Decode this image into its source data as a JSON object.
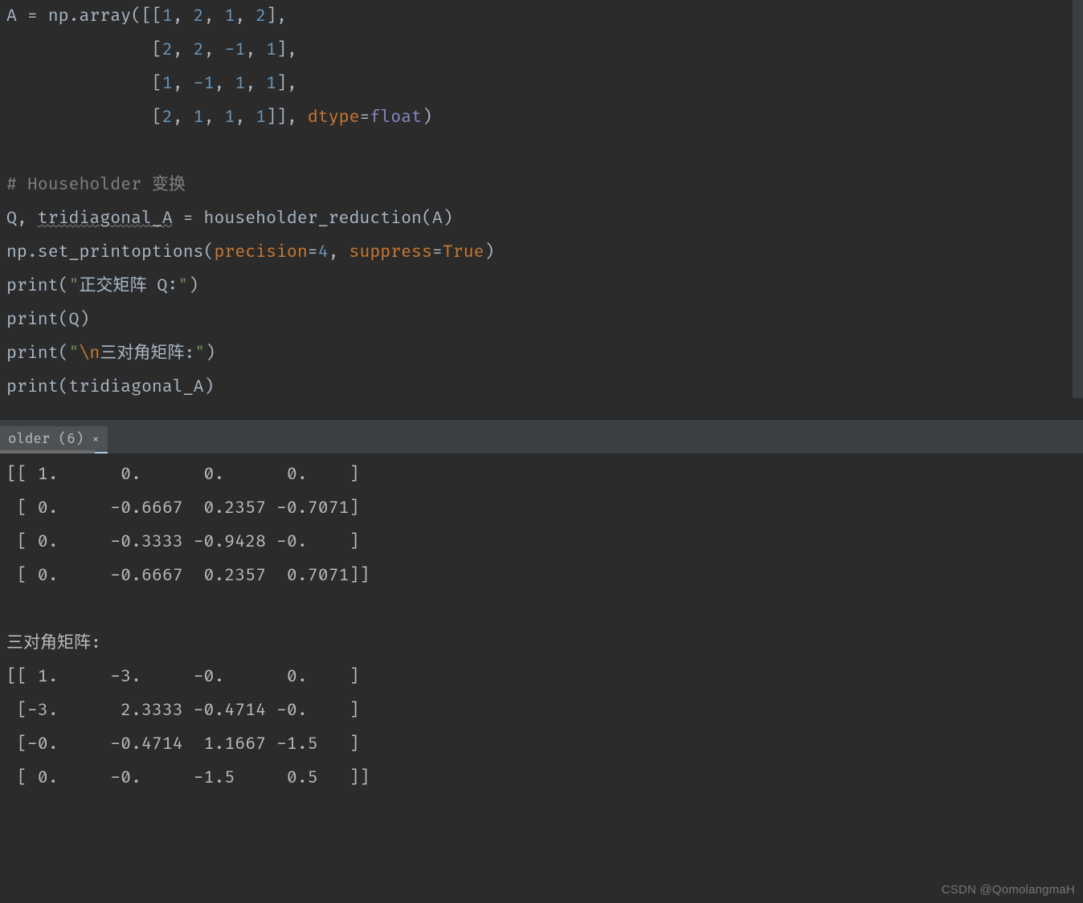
{
  "editor": {
    "lines": [
      {
        "segments": [
          {
            "t": "A = np.array([[",
            "c": "tok-def"
          },
          {
            "t": "1",
            "c": "tok-num"
          },
          {
            "t": ", ",
            "c": "tok-def"
          },
          {
            "t": "2",
            "c": "tok-num"
          },
          {
            "t": ", ",
            "c": "tok-def"
          },
          {
            "t": "1",
            "c": "tok-num"
          },
          {
            "t": ", ",
            "c": "tok-def"
          },
          {
            "t": "2",
            "c": "tok-num"
          },
          {
            "t": "],",
            "c": "tok-def"
          }
        ]
      },
      {
        "segments": [
          {
            "t": "              [",
            "c": "tok-def"
          },
          {
            "t": "2",
            "c": "tok-num"
          },
          {
            "t": ", ",
            "c": "tok-def"
          },
          {
            "t": "2",
            "c": "tok-num"
          },
          {
            "t": ", ",
            "c": "tok-def"
          },
          {
            "t": "-1",
            "c": "tok-num"
          },
          {
            "t": ", ",
            "c": "tok-def"
          },
          {
            "t": "1",
            "c": "tok-num"
          },
          {
            "t": "],",
            "c": "tok-def"
          }
        ]
      },
      {
        "segments": [
          {
            "t": "              [",
            "c": "tok-def"
          },
          {
            "t": "1",
            "c": "tok-num"
          },
          {
            "t": ", ",
            "c": "tok-def"
          },
          {
            "t": "-1",
            "c": "tok-num"
          },
          {
            "t": ", ",
            "c": "tok-def"
          },
          {
            "t": "1",
            "c": "tok-num"
          },
          {
            "t": ", ",
            "c": "tok-def"
          },
          {
            "t": "1",
            "c": "tok-num"
          },
          {
            "t": "],",
            "c": "tok-def"
          }
        ]
      },
      {
        "segments": [
          {
            "t": "              [",
            "c": "tok-def"
          },
          {
            "t": "2",
            "c": "tok-num"
          },
          {
            "t": ", ",
            "c": "tok-def"
          },
          {
            "t": "1",
            "c": "tok-num"
          },
          {
            "t": ", ",
            "c": "tok-def"
          },
          {
            "t": "1",
            "c": "tok-num"
          },
          {
            "t": ", ",
            "c": "tok-def"
          },
          {
            "t": "1",
            "c": "tok-num"
          },
          {
            "t": "]], ",
            "c": "tok-def"
          },
          {
            "t": "dtype",
            "c": "tok-kw"
          },
          {
            "t": "=",
            "c": "tok-def"
          },
          {
            "t": "float",
            "c": "tok-fn"
          },
          {
            "t": ")",
            "c": "tok-def"
          }
        ]
      },
      {
        "segments": [
          {
            "t": " ",
            "c": "tok-def"
          }
        ]
      },
      {
        "segments": [
          {
            "t": "# Householder 变换",
            "c": "tok-comment"
          }
        ]
      },
      {
        "segments": [
          {
            "t": "Q, ",
            "c": "tok-def"
          },
          {
            "t": "tridiagonal_A",
            "c": "tok-def underline-wavy"
          },
          {
            "t": " = householder_reduction(A)",
            "c": "tok-def"
          }
        ]
      },
      {
        "segments": [
          {
            "t": "np.set_printoptions(",
            "c": "tok-def"
          },
          {
            "t": "precision",
            "c": "tok-kw"
          },
          {
            "t": "=",
            "c": "tok-def"
          },
          {
            "t": "4",
            "c": "tok-num"
          },
          {
            "t": ", ",
            "c": "tok-def"
          },
          {
            "t": "suppress",
            "c": "tok-kw"
          },
          {
            "t": "=",
            "c": "tok-def"
          },
          {
            "t": "True",
            "c": "tok-kw"
          },
          {
            "t": ")",
            "c": "tok-def"
          }
        ]
      },
      {
        "segments": [
          {
            "t": "print(",
            "c": "tok-def"
          },
          {
            "t": "\"",
            "c": "tok-str"
          },
          {
            "t": "正交矩阵 Q:",
            "c": "tok-strcn"
          },
          {
            "t": "\"",
            "c": "tok-str"
          },
          {
            "t": ")",
            "c": "tok-def"
          }
        ]
      },
      {
        "segments": [
          {
            "t": "print(Q)",
            "c": "tok-def"
          }
        ]
      },
      {
        "segments": [
          {
            "t": "print(",
            "c": "tok-def"
          },
          {
            "t": "\"",
            "c": "tok-str"
          },
          {
            "t": "\\n",
            "c": "tok-kw"
          },
          {
            "t": "三对角矩阵:",
            "c": "tok-strcn"
          },
          {
            "t": "\"",
            "c": "tok-str"
          },
          {
            "t": ")",
            "c": "tok-def"
          }
        ]
      },
      {
        "segments": [
          {
            "t": "print(tridiagonal_A)",
            "c": "tok-def"
          }
        ]
      }
    ]
  },
  "tab": {
    "label": "older (6)",
    "close": "×"
  },
  "console": {
    "lines": [
      "[[ 1.      0.      0.      0.    ]",
      " [ 0.     -0.6667  0.2357 -0.7071]",
      " [ 0.     -0.3333 -0.9428 -0.    ]",
      " [ 0.     -0.6667  0.2357  0.7071]]",
      "",
      "三对角矩阵:",
      "[[ 1.     -3.     -0.      0.    ]",
      " [-3.      2.3333 -0.4714 -0.    ]",
      " [-0.     -0.4714  1.1667 -1.5   ]",
      " [ 0.     -0.     -1.5     0.5   ]]"
    ]
  },
  "watermark": "CSDN @QomolangmaH"
}
